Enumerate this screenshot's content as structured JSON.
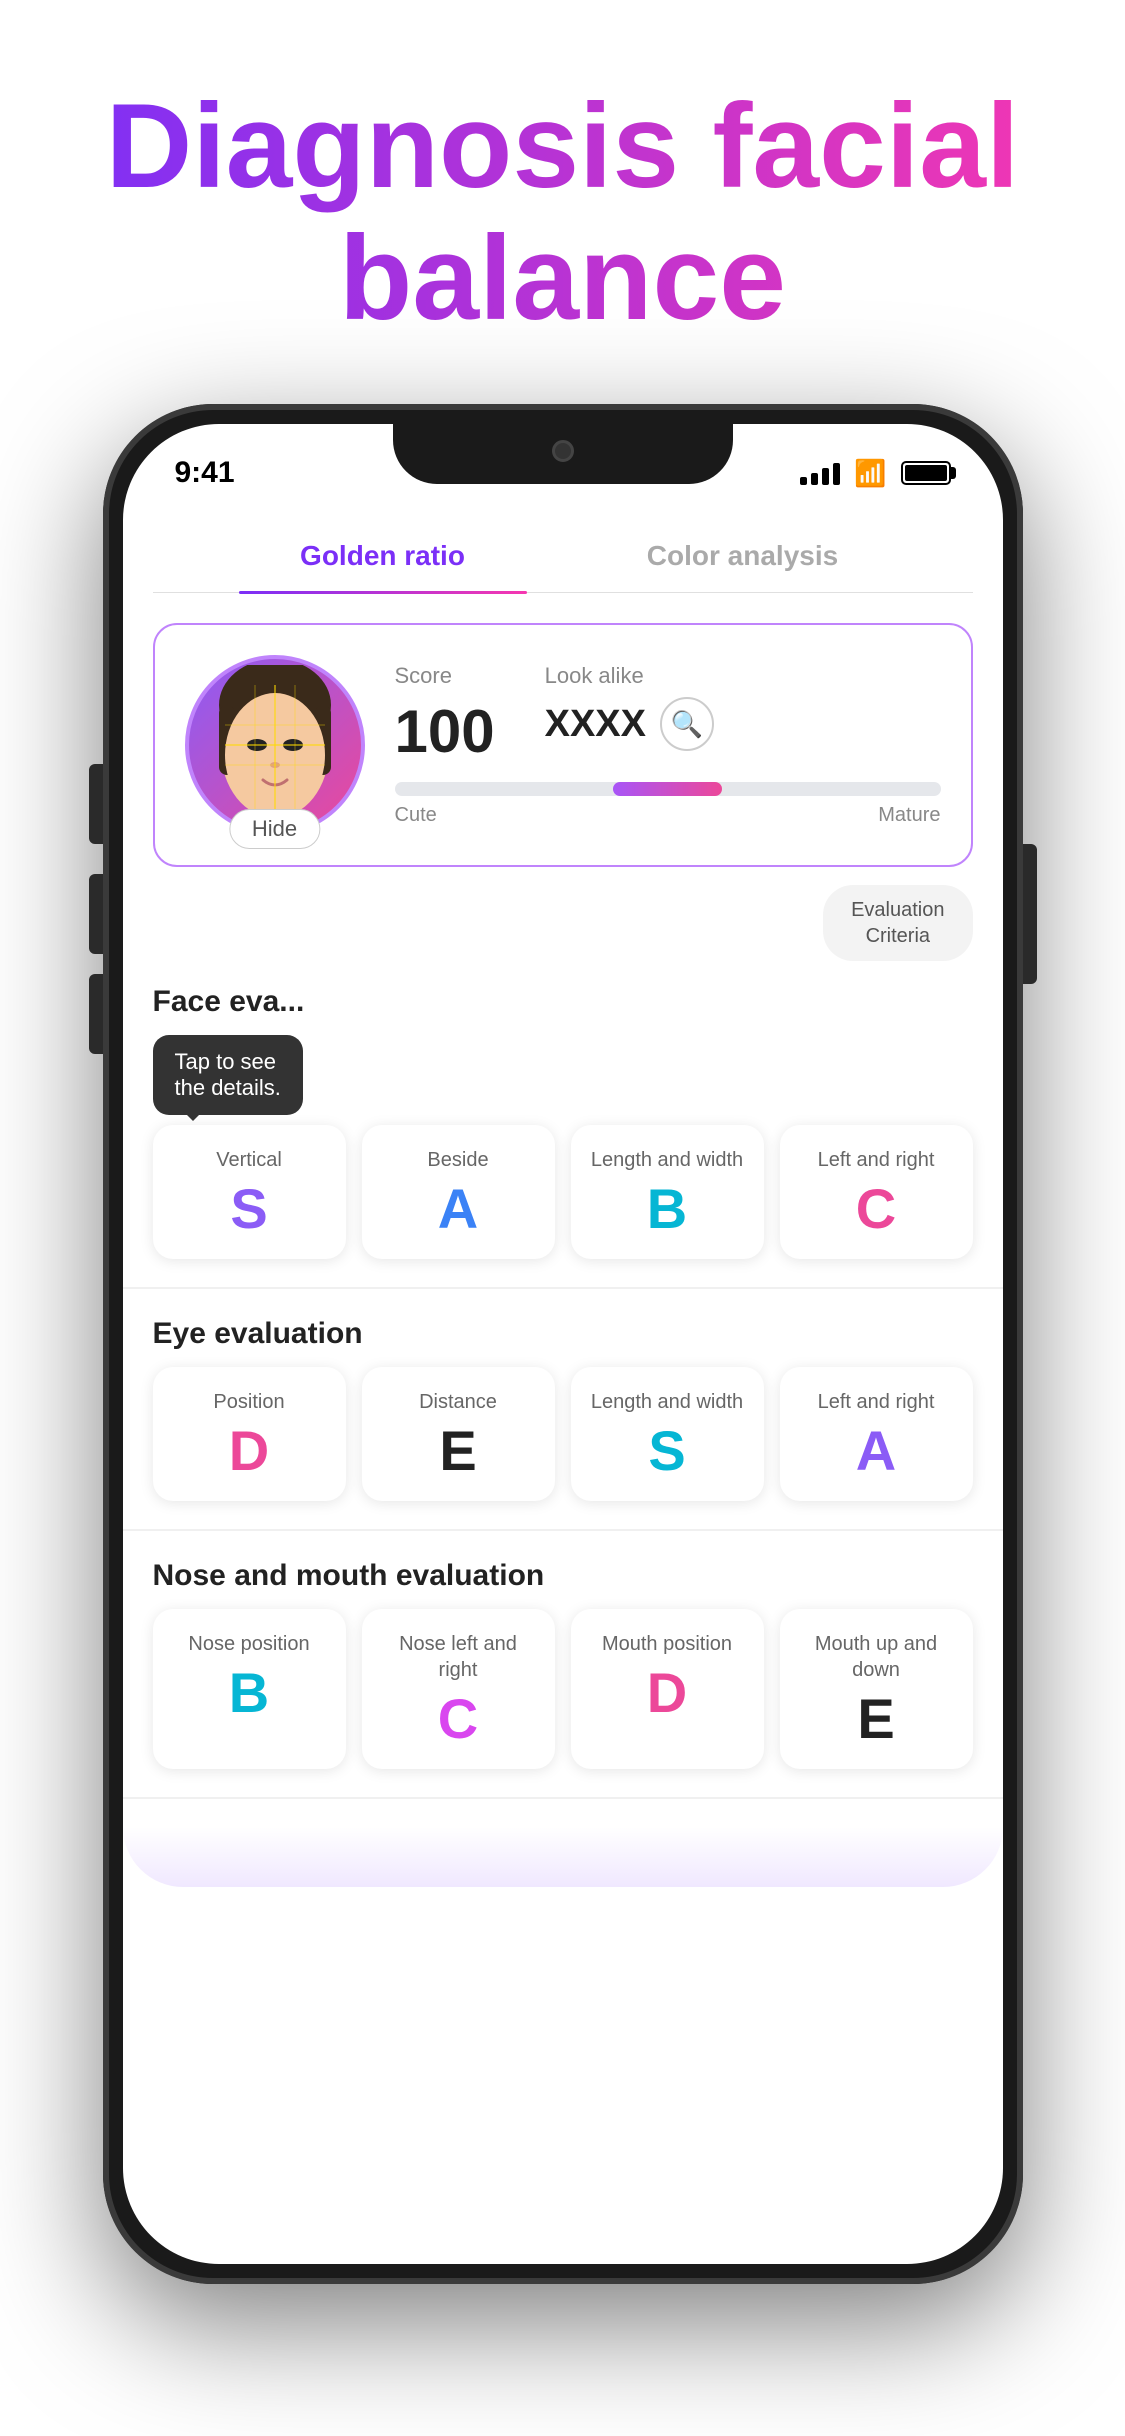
{
  "hero": {
    "title_line1": "Diagnosis facial",
    "title_line2": "balance"
  },
  "status_bar": {
    "time": "9:41"
  },
  "tabs": [
    {
      "id": "golden-ratio",
      "label": "Golden ratio",
      "active": true
    },
    {
      "id": "color-analysis",
      "label": "Color analysis",
      "active": false
    }
  ],
  "score_card": {
    "score_label": "Score",
    "score_value": "100",
    "look_alike_label": "Look alike",
    "look_alike_value": "XXXX",
    "hide_label": "Hide",
    "maturity_label_left": "Cute",
    "maturity_label_right": "Mature"
  },
  "evaluation_criteria_btn": "Evaluation\nCriteria",
  "face_evaluation": {
    "section_title": "Face eva...",
    "tooltip": "Tap to see\nthe details.",
    "cards": [
      {
        "label": "Vertical",
        "grade": "S",
        "color": "purple"
      },
      {
        "label": "Beside",
        "grade": "A",
        "color": "blue"
      },
      {
        "label": "Length and width",
        "grade": "B",
        "color": "cyan"
      },
      {
        "label": "Left and right",
        "grade": "C",
        "color": "pink"
      }
    ]
  },
  "eye_evaluation": {
    "section_title": "Eye evaluation",
    "cards": [
      {
        "label": "Position",
        "grade": "D",
        "color": "pink"
      },
      {
        "label": "Distance",
        "grade": "E",
        "color": "dark"
      },
      {
        "label": "Length and width",
        "grade": "S",
        "color": "cyan"
      },
      {
        "label": "Left and right",
        "grade": "A",
        "color": "purple"
      }
    ]
  },
  "nose_mouth_evaluation": {
    "section_title": "Nose and mouth evaluation",
    "cards": [
      {
        "label": "Nose position",
        "grade": "B",
        "color": "cyan"
      },
      {
        "label": "Nose left and right",
        "grade": "C",
        "color": "magenta"
      },
      {
        "label": "Mouth position",
        "grade": "D",
        "color": "pink"
      },
      {
        "label": "Mouth up and down",
        "grade": "E",
        "color": "dark"
      }
    ]
  }
}
